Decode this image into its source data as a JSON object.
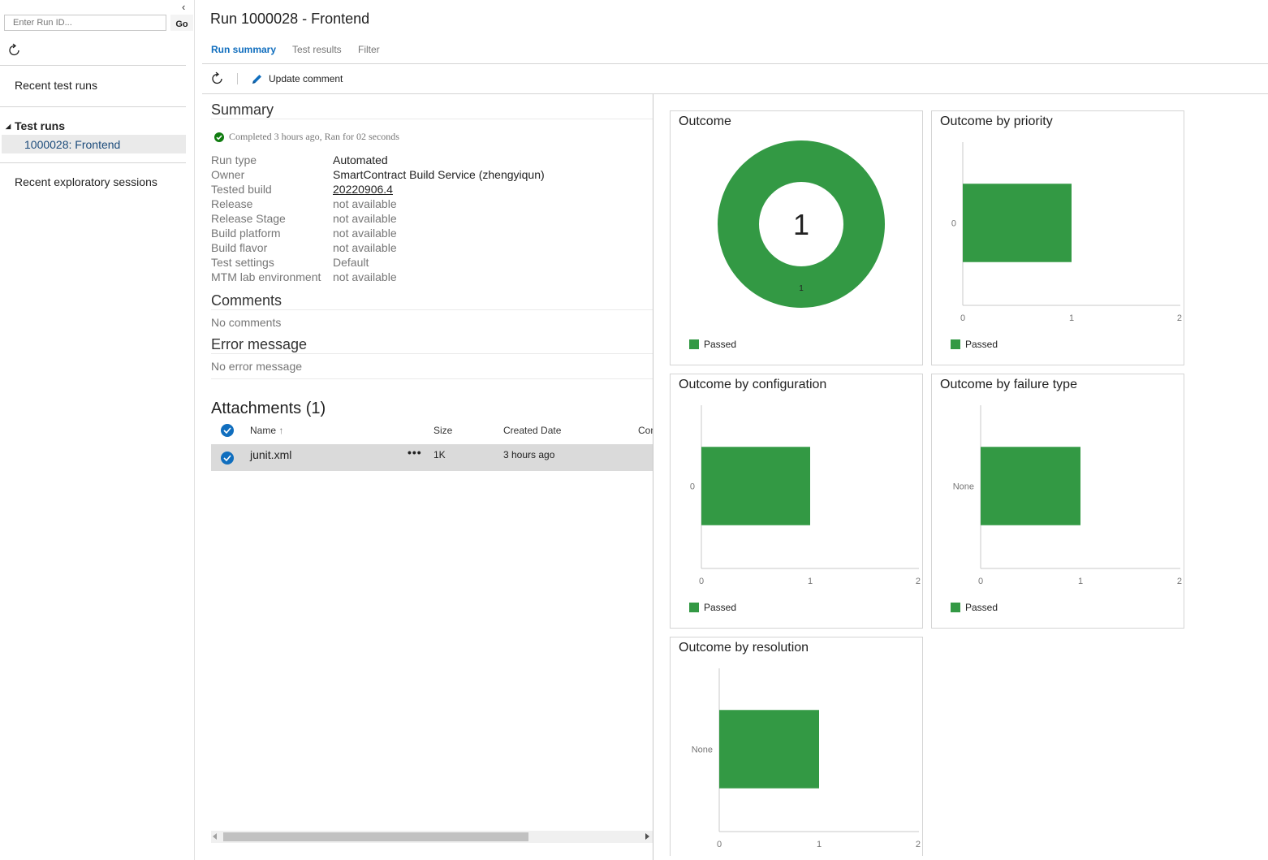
{
  "nav": {
    "collapse_glyph": "‹",
    "runid_placeholder": "Enter Run ID...",
    "go_label": "Go",
    "recent_runs": "Recent test runs",
    "test_runs_header": "Test runs",
    "test_run_item": "1000028: Frontend",
    "recent_sessions": "Recent exploratory sessions"
  },
  "header": {
    "title": "Run 1000028 - Frontend",
    "tabs": [
      "Run summary",
      "Test results",
      "Filter"
    ],
    "update_comment": "Update comment"
  },
  "summary": {
    "title": "Summary",
    "status": "Completed 3 hours ago, Ran for 02 seconds",
    "fields": [
      {
        "label": "Run type",
        "value": "Automated"
      },
      {
        "label": "Owner",
        "value": "SmartContract Build Service (zhengyiqun)"
      },
      {
        "label": "Tested build",
        "value": "20220906.4"
      },
      {
        "label": "Release",
        "value": "not available"
      },
      {
        "label": "Release Stage",
        "value": "not available"
      },
      {
        "label": "Build platform",
        "value": "not available"
      },
      {
        "label": "Build flavor",
        "value": "not available"
      },
      {
        "label": "Test settings",
        "value": "Default"
      },
      {
        "label": "MTM lab environment",
        "value": "not available"
      }
    ],
    "comments_title": "Comments",
    "comments_text": "No comments",
    "error_title": "Error message",
    "error_text": "No error message"
  },
  "attachments": {
    "title": "Attachments (1)",
    "columns": {
      "name": "Name",
      "sort_glyph": "↑",
      "size": "Size",
      "created": "Created Date",
      "comment": "Con"
    },
    "rows": [
      {
        "name": "junit.xml",
        "more": "•••",
        "size": "1K",
        "created": "3 hours ago"
      }
    ]
  },
  "colors": {
    "accent": "#106ebe",
    "passed": "#339944",
    "axis": "#c8c8c8"
  },
  "chart_data": [
    {
      "type": "pie",
      "title": "Outcome",
      "center_label": "1",
      "slices": [
        {
          "name": "Passed",
          "value": 1
        }
      ],
      "legend": [
        "Passed"
      ]
    },
    {
      "type": "bar",
      "orientation": "horizontal",
      "title": "Outcome by priority",
      "categories": [
        "0"
      ],
      "series": [
        {
          "name": "Passed",
          "values": [
            1
          ]
        }
      ],
      "xlim": [
        0,
        2
      ],
      "xticks": [
        "0",
        "1",
        "2"
      ],
      "legend": [
        "Passed"
      ]
    },
    {
      "type": "bar",
      "orientation": "horizontal",
      "title": "Outcome by configuration",
      "categories": [
        "0"
      ],
      "series": [
        {
          "name": "Passed",
          "values": [
            1
          ]
        }
      ],
      "xlim": [
        0,
        2
      ],
      "xticks": [
        "0",
        "1",
        "2"
      ],
      "legend": [
        "Passed"
      ]
    },
    {
      "type": "bar",
      "orientation": "horizontal",
      "title": "Outcome by failure type",
      "categories": [
        "None"
      ],
      "series": [
        {
          "name": "Passed",
          "values": [
            1
          ]
        }
      ],
      "xlim": [
        0,
        2
      ],
      "xticks": [
        "0",
        "1",
        "2"
      ],
      "legend": [
        "Passed"
      ]
    },
    {
      "type": "bar",
      "orientation": "horizontal",
      "title": "Outcome by resolution",
      "categories": [
        "None"
      ],
      "series": [
        {
          "name": "Passed",
          "values": [
            1
          ]
        }
      ],
      "xlim": [
        0,
        2
      ],
      "xticks": [
        "0",
        "1",
        "2"
      ],
      "legend": []
    }
  ]
}
